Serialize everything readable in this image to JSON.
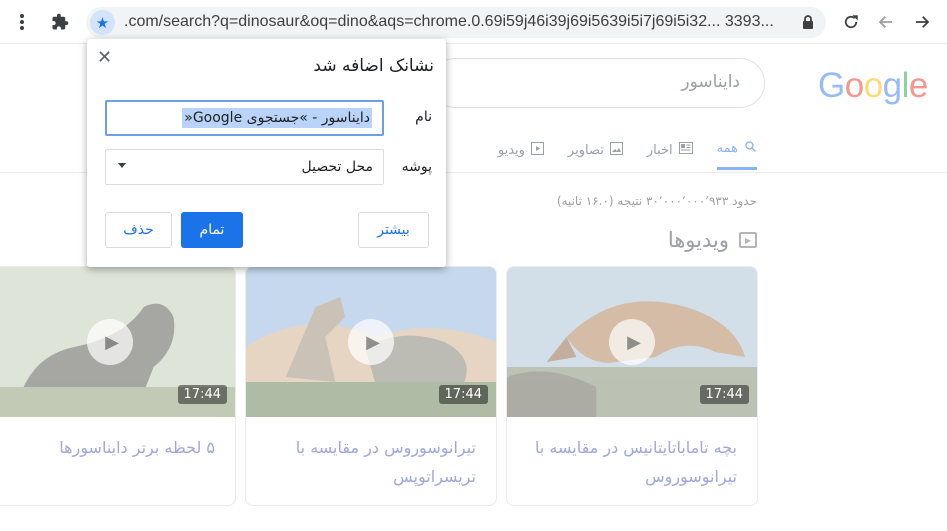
{
  "browser": {
    "url": ".com/search?q=dinosaur&oq=dino&aqs=chrome.0.69i59j46i39j69i5639i5i7j69i5i32... 3393...",
    "icons": [
      "more-vert-icon",
      "extensions-icon",
      "star-icon",
      "lock-icon",
      "reload-icon",
      "back-icon",
      "forward-icon"
    ]
  },
  "page": {
    "search_query": "دایناسور",
    "tabs": [
      {
        "label": "همه",
        "icon": "search-icon",
        "active": true
      },
      {
        "label": "اخبار",
        "icon": "news-icon",
        "active": false
      },
      {
        "label": "تصاویر",
        "icon": "images-icon",
        "active": false
      },
      {
        "label": "ویدیو",
        "icon": "video-icon",
        "active": false
      }
    ],
    "result_stats": "حدود ۳۰٬۰۰۰٬۰۰۰٬۹۳۳ نتیجه (۱۶.۰ ثانیه)",
    "videos_heading": "ویدیوها",
    "videos": [
      {
        "title": "بچه تاماباتایتانیس در مقایسه با تیرانوسوروس",
        "duration": "17:44"
      },
      {
        "title": "تیرانوسوروس در مقایسه با تریسراتوپس",
        "duration": "17:44"
      },
      {
        "title": "۵ لحظه برتر دایناسورها",
        "duration": "17:44"
      }
    ]
  },
  "dialog": {
    "title": "نشانک اضافه شد",
    "close_label": "✕",
    "name_label": "نام",
    "name_value": "دایناسور - »جستجوی Google«",
    "folder_label": "پوشه",
    "folder_value": "محل تحصیل",
    "more_button": "بیشتر",
    "done_button": "تمام",
    "remove_button": "حذف"
  },
  "colors": {
    "accent": "#1a73e8",
    "star_bg": "#d2e3fc",
    "selection": "#b9d4f8"
  }
}
